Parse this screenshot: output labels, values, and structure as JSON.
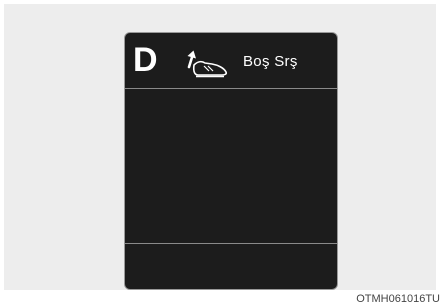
{
  "display": {
    "gear_indicator": "D",
    "message": "Boş Srş",
    "icon": "accelerator-pedal-release-icon"
  },
  "caption": "OTMH061016TU",
  "colors": {
    "screen_background": "#1c1c1c",
    "page_background": "#ededed",
    "text": "#ffffff",
    "divider": "#8a8a8a"
  }
}
